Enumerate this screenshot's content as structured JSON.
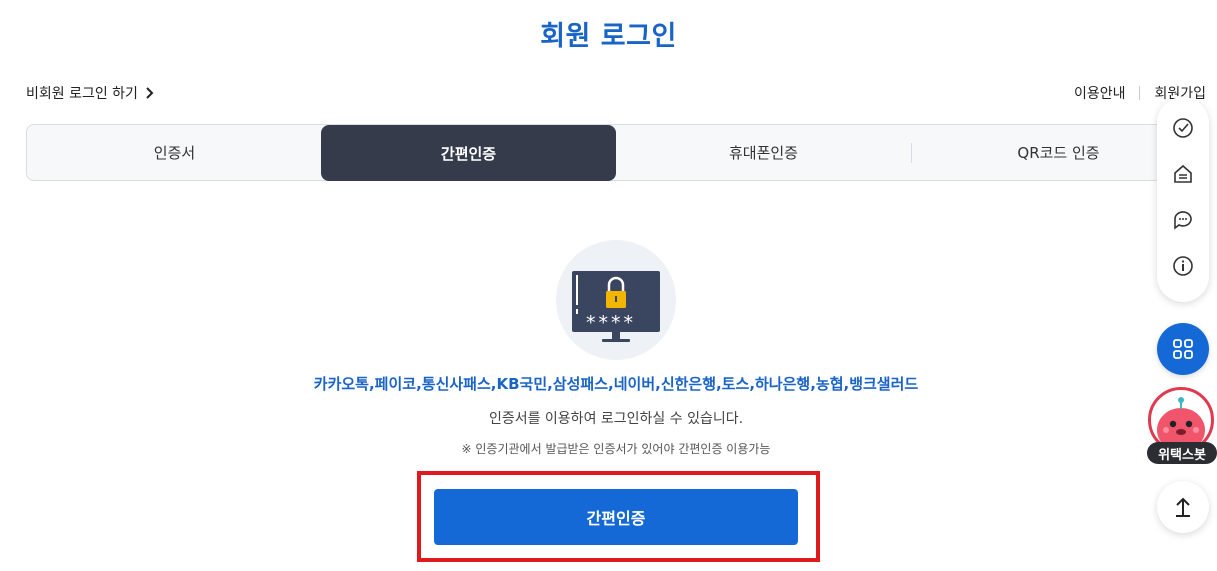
{
  "header": {
    "title": "회원 로그인",
    "nonmember_link": "비회원 로그인 하기",
    "guide_link": "이용안내",
    "signup_link": "회원가입"
  },
  "tabs": [
    {
      "label": "인증서",
      "active": false
    },
    {
      "label": "간편인증",
      "active": true
    },
    {
      "label": "휴대폰인증",
      "active": false
    },
    {
      "label": "QR코드 인증",
      "active": false
    }
  ],
  "content": {
    "providers": "카카오톡,페이코,통신사패스,KB국민,삼성패스,네이버,신한은행,토스,하나은행,농협,뱅크샐러드",
    "description": "인증서를 이용하여 로그인하실 수 있습니다.",
    "note": "※ 인증기관에서 발급받은 인증서가 있어야 간편인증 이용가능",
    "button_label": "간편인증",
    "password_mask": "****"
  },
  "quick_menu": {
    "icons": [
      "check-speech-icon",
      "inbox-icon",
      "chat-icon",
      "info-icon",
      "grid-menu-icon",
      "arrow-up-icon"
    ],
    "bot_label": "위택스봇"
  },
  "colors": {
    "accent": "#1a64c8",
    "button": "#1469d6",
    "active_tab": "#363b4b",
    "highlight": "#e0191f"
  }
}
